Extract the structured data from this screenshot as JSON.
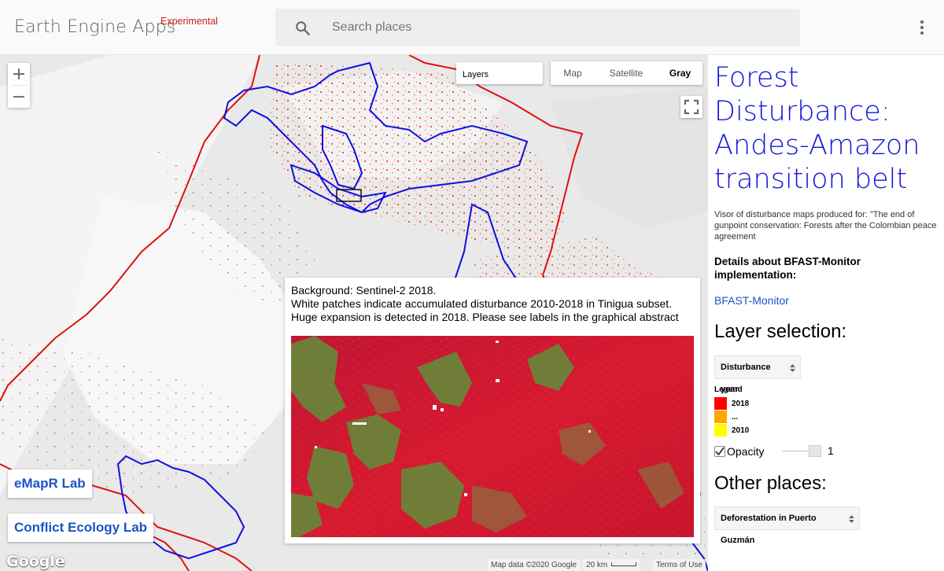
{
  "header": {
    "brand": "Earth Engine Apps",
    "brand_tag": "Experimental",
    "search_placeholder": "Search places"
  },
  "map": {
    "zoom_in": "+",
    "zoom_out": "−",
    "layers_label": "Layers",
    "map_types": [
      "Map",
      "Satellite",
      "Gray"
    ],
    "active_map_type": "Gray",
    "info_panel": {
      "line1": "Background: Sentinel-2 2018.",
      "line2": "White patches indicate accumulated disturbance 2010-2018 in Tinigua subset.",
      "line3": "Huge expansion is detected in 2018. Please see labels in the graphical abstract"
    },
    "lab_buttons": [
      "eMapR Lab",
      "Conflict Ecology Lab"
    ],
    "google_logo": "Google",
    "attribution": "Map data ©2020 Google",
    "scale_label": "20 km",
    "terms": "Terms of Use",
    "colors": {
      "protected_area_border": "#1010e0",
      "region_border": "#e01010",
      "disturbance": "#ff2a10",
      "background": "#ececec"
    }
  },
  "sidebar": {
    "title": "Forest Disturbance: Andes-Amazon transition belt",
    "description": "Visor of disturbance maps produced for: \"The end of gunpoint conservation: Forests after the Colombian peace agreement",
    "details_heading": "Details about BFAST-Monitor implementation:",
    "link_label": "BFAST-Monitor",
    "layer_heading": "Layer selection:",
    "layer_select": "Disturbance year",
    "legend": {
      "title": "Legend",
      "items": [
        {
          "label": "2018",
          "color": "#ff0000"
        },
        {
          "label": "...",
          "color": "#ffa500"
        },
        {
          "label": "2010",
          "color": "#ffff00"
        }
      ]
    },
    "opacity": {
      "label": "Opacity",
      "checked": true,
      "value": "1"
    },
    "places_heading": "Other places:",
    "places_select": "Deforestation in Puerto Guzmán"
  }
}
